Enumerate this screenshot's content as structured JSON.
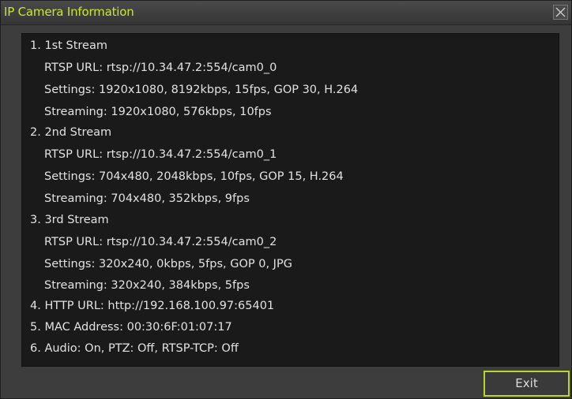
{
  "window": {
    "title": "IP Camera Information"
  },
  "lines": [
    "1. 1st Stream",
    "RTSP URL: rtsp://10.34.47.2:554/cam0_0",
    "Settings: 1920x1080, 8192kbps, 15fps, GOP 30, H.264",
    "Streaming: 1920x1080, 576kbps, 10fps",
    "2. 2nd Stream",
    "RTSP URL: rtsp://10.34.47.2:554/cam0_1",
    "Settings: 704x480, 2048kbps, 10fps, GOP 15, H.264",
    "Streaming: 704x480, 352kbps, 9fps",
    "3. 3rd Stream",
    "RTSP URL: rtsp://10.34.47.2:554/cam0_2",
    "Settings: 320x240, 0kbps, 5fps, GOP 0, JPG",
    "Streaming: 320x240, 384kbps, 5fps",
    "4. HTTP URL: http://192.168.100.97:65401",
    "5. MAC Address: 00:30:6F:01:07:17",
    "6. Audio: On, PTZ: Off, RTSP-TCP: Off"
  ],
  "buttons": {
    "exit": "Exit"
  },
  "colors": {
    "title": "#c8e830",
    "exit_border": "#b6d82a"
  }
}
